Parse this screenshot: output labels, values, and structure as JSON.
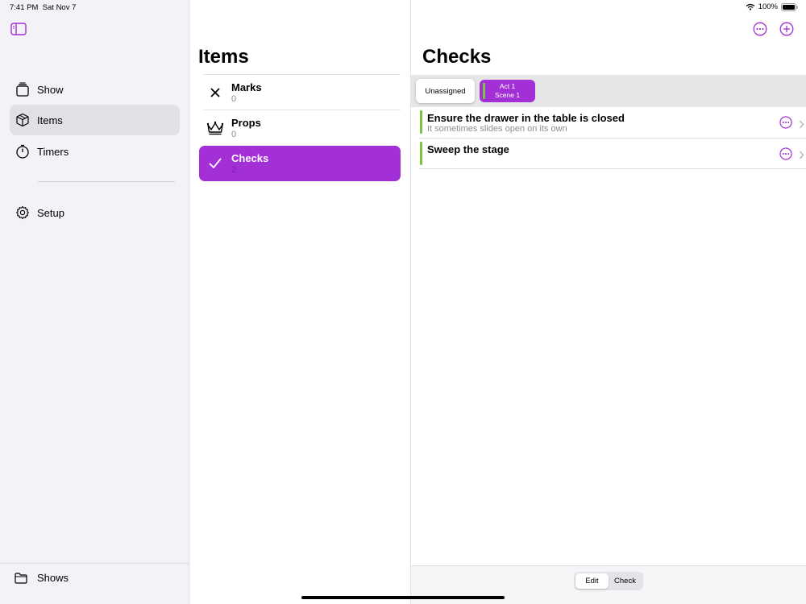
{
  "status_bar": {
    "time": "7:41 PM",
    "date": "Sat Nov 7",
    "battery": "100%"
  },
  "colors": {
    "accent": "#a32fd6",
    "scene_bar": "#7cc444"
  },
  "sidebar": {
    "toggle_icon": "sidebar-icon",
    "items": [
      {
        "label": "Show",
        "icon": "square-stack-icon"
      },
      {
        "label": "Items",
        "icon": "cube-icon",
        "selected": true
      },
      {
        "label": "Timers",
        "icon": "timer-icon"
      },
      {
        "label": "Setup",
        "icon": "gear-icon"
      }
    ],
    "footer": {
      "label": "Shows",
      "icon": "folder-icon"
    }
  },
  "items_panel": {
    "title": "Items",
    "items": [
      {
        "name": "Marks",
        "count": "0",
        "icon": "xmark-icon"
      },
      {
        "name": "Props",
        "count": "0",
        "icon": "crown-icon"
      },
      {
        "name": "Checks",
        "count": "2",
        "icon": "checkmark-icon",
        "selected": true
      }
    ]
  },
  "checks_panel": {
    "title": "Checks",
    "filters": {
      "unassigned": "Unassigned",
      "scene_line1": "Act 1",
      "scene_line2": "Scene 1"
    },
    "rows": [
      {
        "title": "Ensure the drawer in the table is closed",
        "subtitle": "It sometimes slides open on its own"
      },
      {
        "title": "Sweep the stage",
        "subtitle": ""
      }
    ],
    "mode": {
      "edit": "Edit",
      "check": "Check",
      "selected": "Edit"
    }
  }
}
